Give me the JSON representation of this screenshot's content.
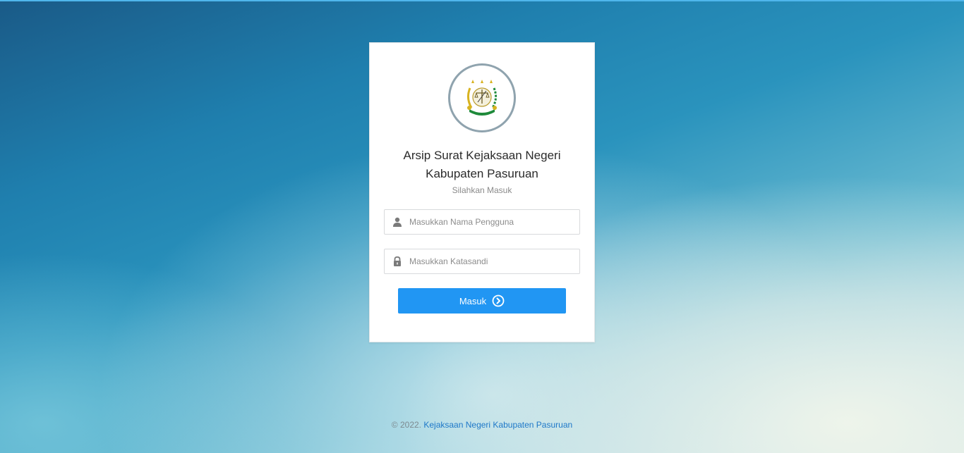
{
  "app": {
    "title_line1": "Arsip Surat Kejaksaan Negeri",
    "title_line2": "Kabupaten Pasuruan",
    "subtitle": "Silahkan Masuk"
  },
  "form": {
    "username_placeholder": "Masukkan Nama Pengguna",
    "username_value": "",
    "password_placeholder": "Masukkan Katasandi",
    "password_value": "",
    "submit_label": "Masuk"
  },
  "footer": {
    "copyright": "© 2022.",
    "link_text": "Kejaksaan Negeri Kabupaten Pasuruan"
  },
  "icons": {
    "logo": "kejaksaan-emblem-icon",
    "username": "user-icon",
    "password": "lock-icon",
    "submit": "chevron-circle-right-icon"
  },
  "colors": {
    "accent": "#2196f3",
    "link": "#1e78c8",
    "top_bar": "#4fb6ec"
  }
}
